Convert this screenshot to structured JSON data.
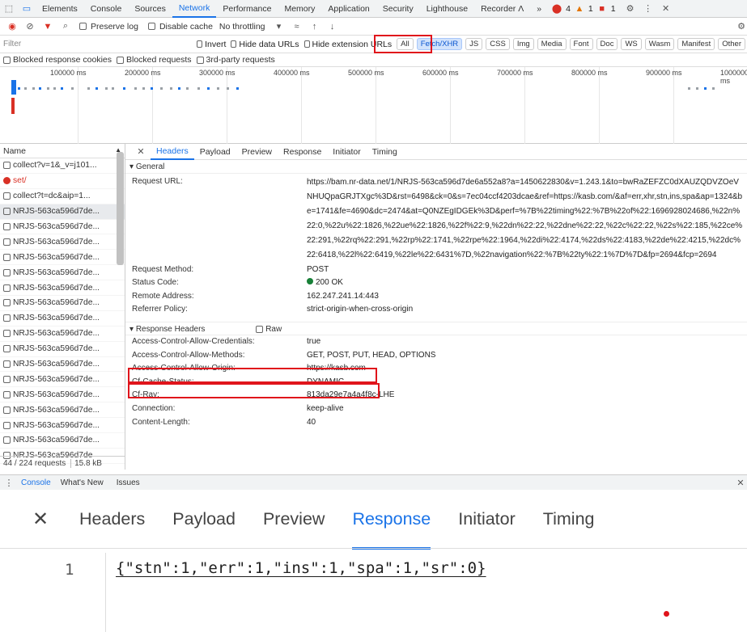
{
  "tabs": [
    "Elements",
    "Console",
    "Sources",
    "Network",
    "Performance",
    "Memory",
    "Application",
    "Security",
    "Lighthouse",
    "Recorder Ʌ"
  ],
  "tabs_more": "»",
  "counts": {
    "errors": "4",
    "warnings": "1",
    "issues": "1"
  },
  "toolbar": {
    "preserve_log": "Preserve log",
    "disable_cache": "Disable cache",
    "throttling": "No throttling"
  },
  "filter": {
    "placeholder": "Filter",
    "invert": "Invert",
    "hide_data_urls": "Hide data URLs",
    "hide_ext_urls": "Hide extension URLs"
  },
  "type_filters": [
    "All",
    "Fetch/XHR",
    "JS",
    "CSS",
    "Img",
    "Media",
    "Font",
    "Doc",
    "WS",
    "Wasm",
    "Manifest",
    "Other"
  ],
  "type_selected": "Fetch/XHR",
  "row3": {
    "blocked_cookies": "Blocked response cookies",
    "blocked_requests": "Blocked requests",
    "third_party": "3rd-party requests"
  },
  "timeline_ticks": [
    "100000 ms",
    "200000 ms",
    "300000 ms",
    "400000 ms",
    "500000 ms",
    "600000 ms",
    "700000 ms",
    "800000 ms",
    "900000 ms",
    "1000000 ms"
  ],
  "requests": {
    "header": "Name",
    "items": [
      {
        "name": "collect?v=1&_v=j101...",
        "kind": "normal"
      },
      {
        "name": "set/",
        "kind": "error"
      },
      {
        "name": "collect?t=dc&aip=1...",
        "kind": "normal"
      },
      {
        "name": "NRJS-563ca596d7de...",
        "kind": "selected"
      },
      {
        "name": "NRJS-563ca596d7de...",
        "kind": "normal"
      },
      {
        "name": "NRJS-563ca596d7de...",
        "kind": "normal"
      },
      {
        "name": "NRJS-563ca596d7de...",
        "kind": "normal"
      },
      {
        "name": "NRJS-563ca596d7de...",
        "kind": "normal"
      },
      {
        "name": "NRJS-563ca596d7de...",
        "kind": "normal"
      },
      {
        "name": "NRJS-563ca596d7de...",
        "kind": "normal"
      },
      {
        "name": "NRJS-563ca596d7de...",
        "kind": "normal"
      },
      {
        "name": "NRJS-563ca596d7de...",
        "kind": "normal"
      },
      {
        "name": "NRJS-563ca596d7de...",
        "kind": "normal"
      },
      {
        "name": "NRJS-563ca596d7de...",
        "kind": "normal"
      },
      {
        "name": "NRJS-563ca596d7de...",
        "kind": "normal"
      },
      {
        "name": "NRJS-563ca596d7de...",
        "kind": "normal"
      },
      {
        "name": "NRJS-563ca596d7de...",
        "kind": "normal"
      },
      {
        "name": "NRJS-563ca596d7de...",
        "kind": "normal"
      },
      {
        "name": "NRJS-563ca596d7de...",
        "kind": "normal"
      },
      {
        "name": "NRJS-563ca596d7de",
        "kind": "normal"
      }
    ],
    "footer_count": "44 / 224 requests",
    "footer_size": "15.8 kB"
  },
  "detail_tabs": [
    "Headers",
    "Payload",
    "Preview",
    "Response",
    "Initiator",
    "Timing"
  ],
  "detail_selected": "Headers",
  "general": {
    "title": "General",
    "request_url_label": "Request URL:",
    "request_url": "https://bam.nr-data.net/1/NRJS-563ca596d7de6a552a8?a=1450622830&v=1.243.1&to=bwRaZEFZC0dXAUZQDVZOeVNHUQpaGRJTXgc%3D&rst=6498&ck=0&s=7ec04ccf4203dcae&ref=https://kasb.com/&af=err,xhr,stn,ins,spa&ap=1324&be=1741&fe=4690&dc=2474&at=Q0NZEgIDGEk%3D&perf=%7B%22timing%22:%7B%22of%22:1696928024686,%22n%22:0,%22u%22:1826,%22ue%22:1826,%22f%22:9,%22dn%22:22,%22dne%22:22,%22c%22:22,%22s%22:185,%22ce%22:291,%22rq%22:291,%22rp%22:1741,%22rpe%22:1964,%22di%22:4174,%22ds%22:4183,%22de%22:4215,%22dc%22:6418,%22l%22:6419,%22le%22:6431%7D,%22navigation%22:%7B%22ty%22:1%7D%7D&fp=2694&fcp=2694",
    "method_label": "Request Method:",
    "method": "POST",
    "status_label": "Status Code:",
    "status": "200 OK",
    "remote_label": "Remote Address:",
    "remote": "162.247.241.14:443",
    "referrer_label": "Referrer Policy:",
    "referrer": "strict-origin-when-cross-origin"
  },
  "response_headers": {
    "title": "Response Headers",
    "raw": "Raw",
    "items": [
      {
        "k": "Access-Control-Allow-Credentials:",
        "v": "true"
      },
      {
        "k": "Access-Control-Allow-Methods:",
        "v": "GET, POST, PUT, HEAD, OPTIONS"
      },
      {
        "k": "Access-Control-Allow-Origin:",
        "v": "https://kasb.com"
      },
      {
        "k": "Cf-Cache-Status:",
        "v": "DYNAMIC"
      },
      {
        "k": "Cf-Ray:",
        "v": "813da29e7a4a4f8c-LHE"
      },
      {
        "k": "Connection:",
        "v": "keep-alive"
      },
      {
        "k": "Content-Length:",
        "v": "40"
      }
    ]
  },
  "drawer": {
    "console": "Console",
    "whats_new": "What's New",
    "issues": "Issues"
  },
  "zoom": {
    "tabs": [
      "Headers",
      "Payload",
      "Preview",
      "Response",
      "Initiator",
      "Timing"
    ],
    "selected": "Response",
    "line_no": "1",
    "code": "{\"stn\":1,\"err\":1,\"ins\":1,\"spa\":1,\"sr\":0}"
  },
  "colors": {
    "accent": "#1a73e8",
    "highlight": "#e0141b",
    "status_ok": "#188038"
  }
}
